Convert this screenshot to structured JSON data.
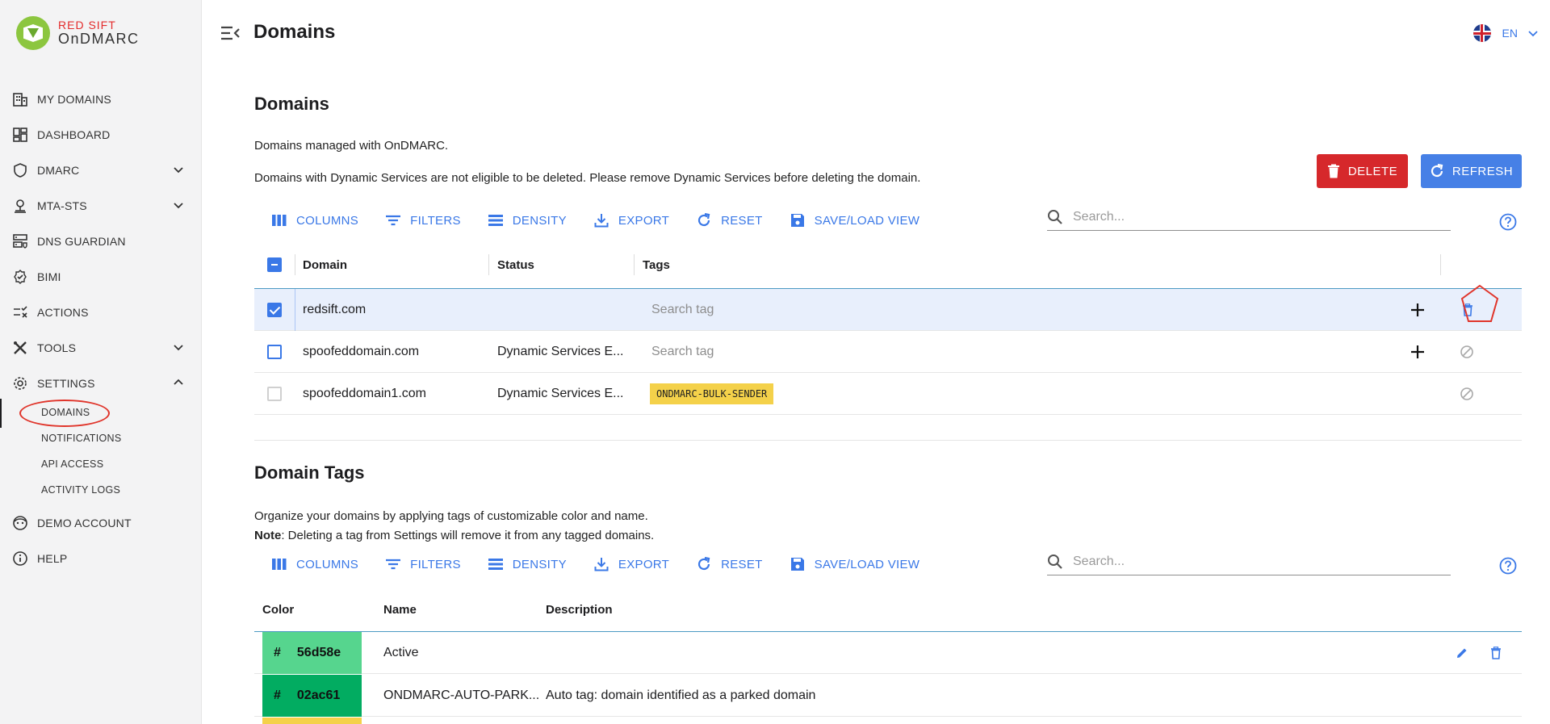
{
  "brand": {
    "line1": "RED SIFT",
    "line2": "OnDMARC"
  },
  "sidebar": {
    "items": [
      {
        "label": "MY DOMAINS",
        "icon": "building-icon"
      },
      {
        "label": "DASHBOARD",
        "icon": "dashboard-icon"
      },
      {
        "label": "DMARC",
        "icon": "shield-icon"
      },
      {
        "label": "MTA-STS",
        "icon": "location-icon"
      },
      {
        "label": "DNS GUARDIAN",
        "icon": "dns-icon"
      },
      {
        "label": "BIMI",
        "icon": "verified-icon"
      },
      {
        "label": "ACTIONS",
        "icon": "checklist-icon"
      },
      {
        "label": "TOOLS",
        "icon": "tools-icon"
      },
      {
        "label": "SETTINGS",
        "icon": "gear-icon"
      },
      {
        "label": "DEMO ACCOUNT",
        "icon": "face-icon"
      },
      {
        "label": "HELP",
        "icon": "info-icon"
      }
    ],
    "settings_sub": [
      "DOMAINS",
      "NOTIFICATIONS",
      "API ACCESS",
      "ACTIVITY LOGS"
    ]
  },
  "header": {
    "title": "Domains",
    "language": "EN"
  },
  "domains": {
    "title": "Domains",
    "desc1": "Domains managed with OnDMARC.",
    "desc2": "Domains with Dynamic Services are not eligible to be deleted. Please remove Dynamic Services before deleting the domain.",
    "delete_label": "DELETE",
    "refresh_label": "REFRESH",
    "toolbar": {
      "columns": "COLUMNS",
      "filters": "FILTERS",
      "density": "DENSITY",
      "export": "EXPORT",
      "reset": "RESET",
      "saveload": "SAVE/LOAD VIEW"
    },
    "search_placeholder": "Search...",
    "columns": {
      "domain": "Domain",
      "status": "Status",
      "tags": "Tags"
    },
    "rows": [
      {
        "domain": "redsift.com",
        "status": "",
        "tag_placeholder": "Search tag"
      },
      {
        "domain": "spoofeddomain.com",
        "status": "Dynamic Services E...",
        "tag_placeholder": "Search tag"
      },
      {
        "domain": "spoofeddomain1.com",
        "status": "Dynamic Services E...",
        "tag": "ONDMARC-BULK-SENDER"
      }
    ]
  },
  "tags": {
    "title": "Domain Tags",
    "desc1": "Organize your domains by applying tags of customizable color and name.",
    "note_label": "Note",
    "note_text": ": Deleting a tag from Settings will remove it from any tagged domains.",
    "toolbar": {
      "columns": "COLUMNS",
      "filters": "FILTERS",
      "density": "DENSITY",
      "export": "EXPORT",
      "reset": "RESET",
      "saveload": "SAVE/LOAD VIEW"
    },
    "search_placeholder": "Search...",
    "columns": {
      "color": "Color",
      "name": "Name",
      "description": "Description"
    },
    "rows": [
      {
        "hash": "#",
        "color": "56d58e",
        "name": "Active",
        "description": ""
      },
      {
        "hash": "#",
        "color": "02ac61",
        "name": "ONDMARC-AUTO-PARK...",
        "description": "Auto tag: domain identified as a parked domain"
      }
    ]
  },
  "colors": {
    "accent": "#3a78e7",
    "delete": "#d6282b",
    "refresh": "#4680e6",
    "tag_bulk": "#f4d14a",
    "swatch1": "#56d58e",
    "swatch2": "#02ac61",
    "annotation": "#e0352b"
  }
}
